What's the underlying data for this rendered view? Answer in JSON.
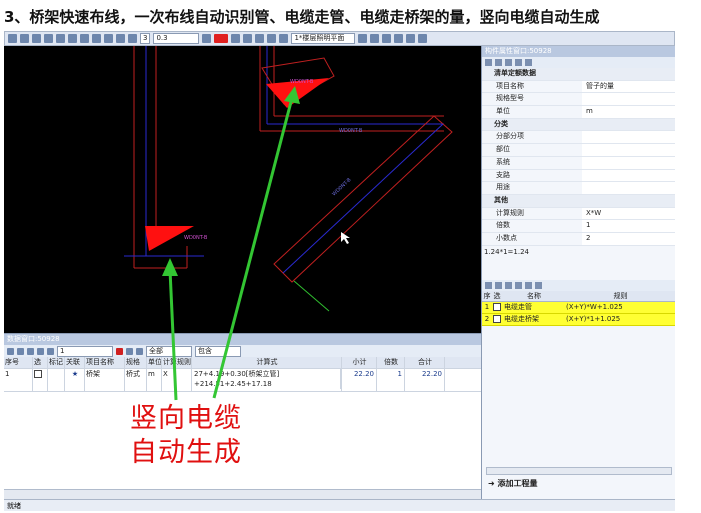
{
  "heading": "3、桥架快速布线，一次布线自动识别管、电缆走管、电缆走桥架的量，竖向电缆自动生成",
  "toolbar": {
    "linewidth": "3",
    "scale": "0.3",
    "plan": "1*楼层照明平面"
  },
  "cad": {
    "labels": [
      "WD0NT-B",
      "WD0NT-B",
      "WD0NT-B",
      "WD0NT-B"
    ]
  },
  "prop_panel": {
    "title": "构件属性窗口:50928",
    "sections": [
      {
        "name": "清单定额数据",
        "rows": [
          {
            "k": "项目名称",
            "v": "管子的量"
          },
          {
            "k": "规格型号",
            "v": ""
          },
          {
            "k": "单位",
            "v": "m"
          }
        ]
      },
      {
        "name": "分类",
        "rows": [
          {
            "k": "分部分项",
            "v": ""
          },
          {
            "k": "部位",
            "v": ""
          },
          {
            "k": "系统",
            "v": ""
          },
          {
            "k": "支路",
            "v": ""
          },
          {
            "k": "用途",
            "v": ""
          }
        ]
      },
      {
        "name": "其他",
        "rows": [
          {
            "k": "计算规则",
            "v": "X*W"
          },
          {
            "k": "倍数",
            "v": "1"
          },
          {
            "k": "小数点",
            "v": "2"
          }
        ]
      }
    ],
    "formula_note": "1.24*1=1.24",
    "rules_header": {
      "idx": "序",
      "sel": "选",
      "name": "名称",
      "rule": "规则"
    },
    "rules": [
      {
        "idx": "1",
        "name": "电缆走管",
        "rule": "(X+Y)*W+1.025"
      },
      {
        "idx": "2",
        "name": "电缆走桥架",
        "rule": "(X+Y)*1+1.025"
      }
    ],
    "add_button": "添加工程量"
  },
  "data_window": {
    "title": "数据窗口:50928",
    "filter_all": "全部",
    "filter_contains": "包含",
    "page": "1",
    "columns": [
      "序号",
      "选",
      "标记",
      "关联",
      "项目名称",
      "规格",
      "单位",
      "计算规则",
      "计算式",
      "小计",
      "倍数",
      "合计"
    ],
    "rows": [
      {
        "no": "1",
        "assoc": "★",
        "name": "桥架",
        "spec": "桥式",
        "unit": "m",
        "rule": "X",
        "expr1": "27+4.19+0.30[桥架立管]",
        "expr2": "+214.51+2.45+17.18",
        "subtotal": "22.20",
        "mult": "1",
        "total": "22.20"
      }
    ]
  },
  "callout": {
    "line1": "竖向电缆",
    "line2": "自动生成"
  },
  "status": "就绪"
}
